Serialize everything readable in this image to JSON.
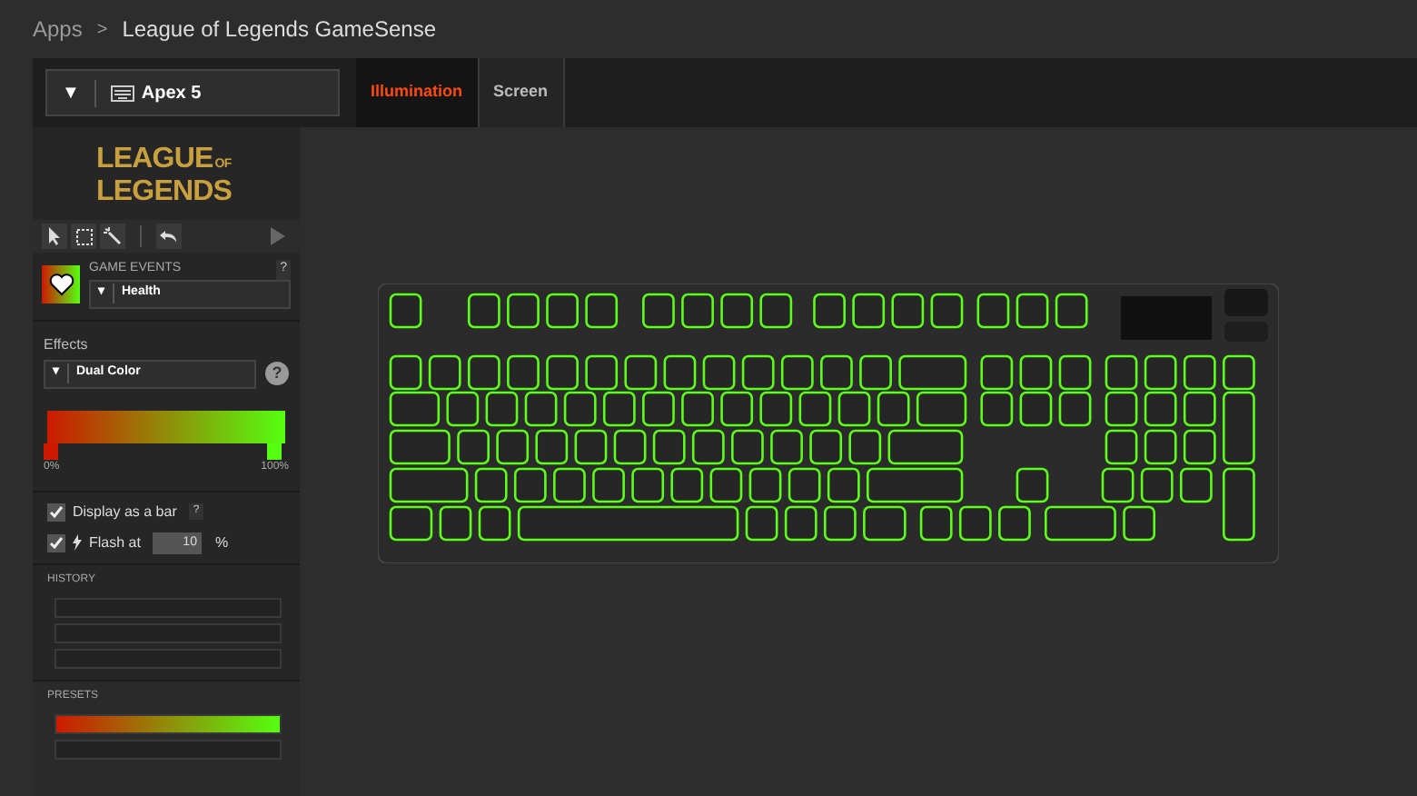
{
  "breadcrumb": {
    "root": "Apps",
    "separator": ">",
    "current": "League of Legends GameSense"
  },
  "device": {
    "arrow": "▼",
    "name": "Apex 5"
  },
  "tabs": [
    {
      "label": "Illumination",
      "selected": true
    },
    {
      "label": "Screen",
      "selected": false
    }
  ],
  "logo": {
    "line1": "LEAGUE",
    "small": "OF",
    "line2": "LEGENDS"
  },
  "game_events": {
    "label": "GAME EVENTS",
    "help": "?",
    "arrow": "▾",
    "value": "Health"
  },
  "effects": {
    "label": "Effects",
    "arrow": "▾",
    "value": "Dual Color",
    "help": "?",
    "stops": [
      {
        "color": "#cc1a00",
        "label": "0%"
      },
      {
        "color": "#55ff11",
        "label": "100%"
      }
    ]
  },
  "options": [
    {
      "kind": "bar",
      "label": "Display as a bar",
      "checked": true,
      "help": "?"
    },
    {
      "kind": "flash",
      "label": "Flash at",
      "checked": true,
      "value": "10",
      "unit": "%"
    }
  ],
  "history": {
    "label": "HISTORY",
    "slots": [
      {
        "kind": "empty"
      },
      {
        "kind": "empty"
      },
      {
        "kind": "empty"
      }
    ]
  },
  "presets": {
    "label": "PRESETS",
    "items": [
      {
        "kind": "gradient"
      },
      {
        "kind": "empty"
      }
    ]
  }
}
